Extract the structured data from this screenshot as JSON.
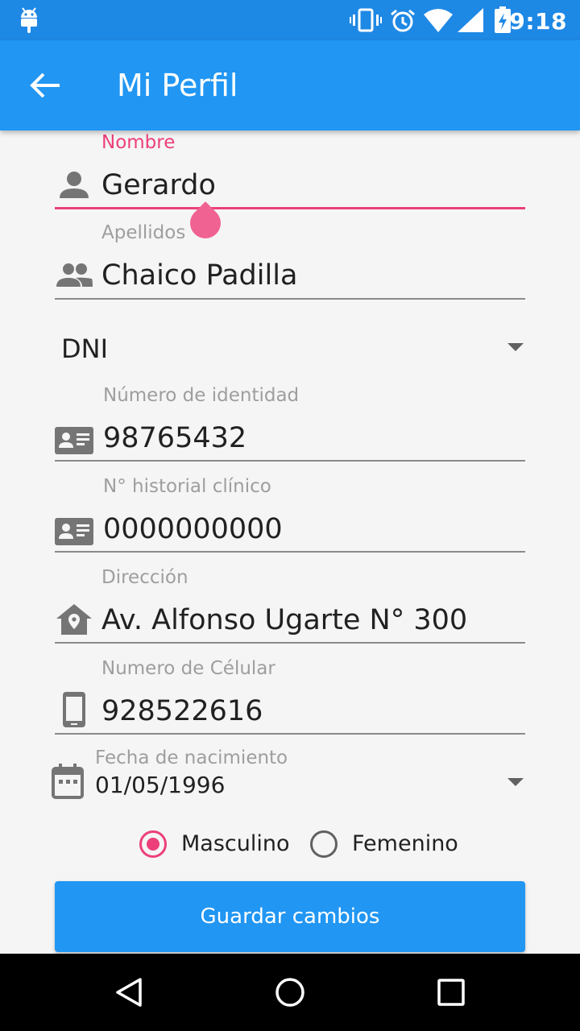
{
  "status_bar": {
    "time": "9:18",
    "icons": [
      "android-icon",
      "vibrate-icon",
      "alarm-icon",
      "wifi-icon",
      "signal-icon",
      "battery-charging-icon"
    ]
  },
  "app_bar": {
    "title": "Mi Perfil",
    "back_icon": "arrow-left-icon"
  },
  "form": {
    "nombre": {
      "label": "Nombre",
      "value": "Gerardo",
      "icon": "person-icon"
    },
    "apellidos": {
      "label": "Apellidos",
      "value": "Chaico Padilla",
      "icon": "group-icon"
    },
    "documento_tipo": {
      "value": "DNI"
    },
    "numero_identidad": {
      "label": "Número de identidad",
      "value": "98765432",
      "icon": "id-card-icon"
    },
    "historial": {
      "label": "N° historial clínico",
      "value": "0000000000",
      "icon": "id-card-icon"
    },
    "direccion": {
      "label": "Dirección",
      "value": "Av. Alfonso Ugarte N° 300",
      "icon": "home-location-icon"
    },
    "celular": {
      "label": "Numero de Célular",
      "value": "928522616",
      "icon": "phone-icon"
    },
    "fecha": {
      "label": "Fecha de nacimiento",
      "value": "01/05/1996",
      "icon": "calendar-icon"
    },
    "genero": {
      "options": [
        "Masculino",
        "Femenino"
      ],
      "selected": "Masculino"
    },
    "save_label": "Guardar cambios"
  },
  "colors": {
    "primary": "#2196f3",
    "primary_dark": "#1e88e5",
    "accent": "#ec407a"
  },
  "nav_bar": {
    "icons": [
      "back-triangle-icon",
      "home-circle-icon",
      "recents-square-icon"
    ]
  }
}
